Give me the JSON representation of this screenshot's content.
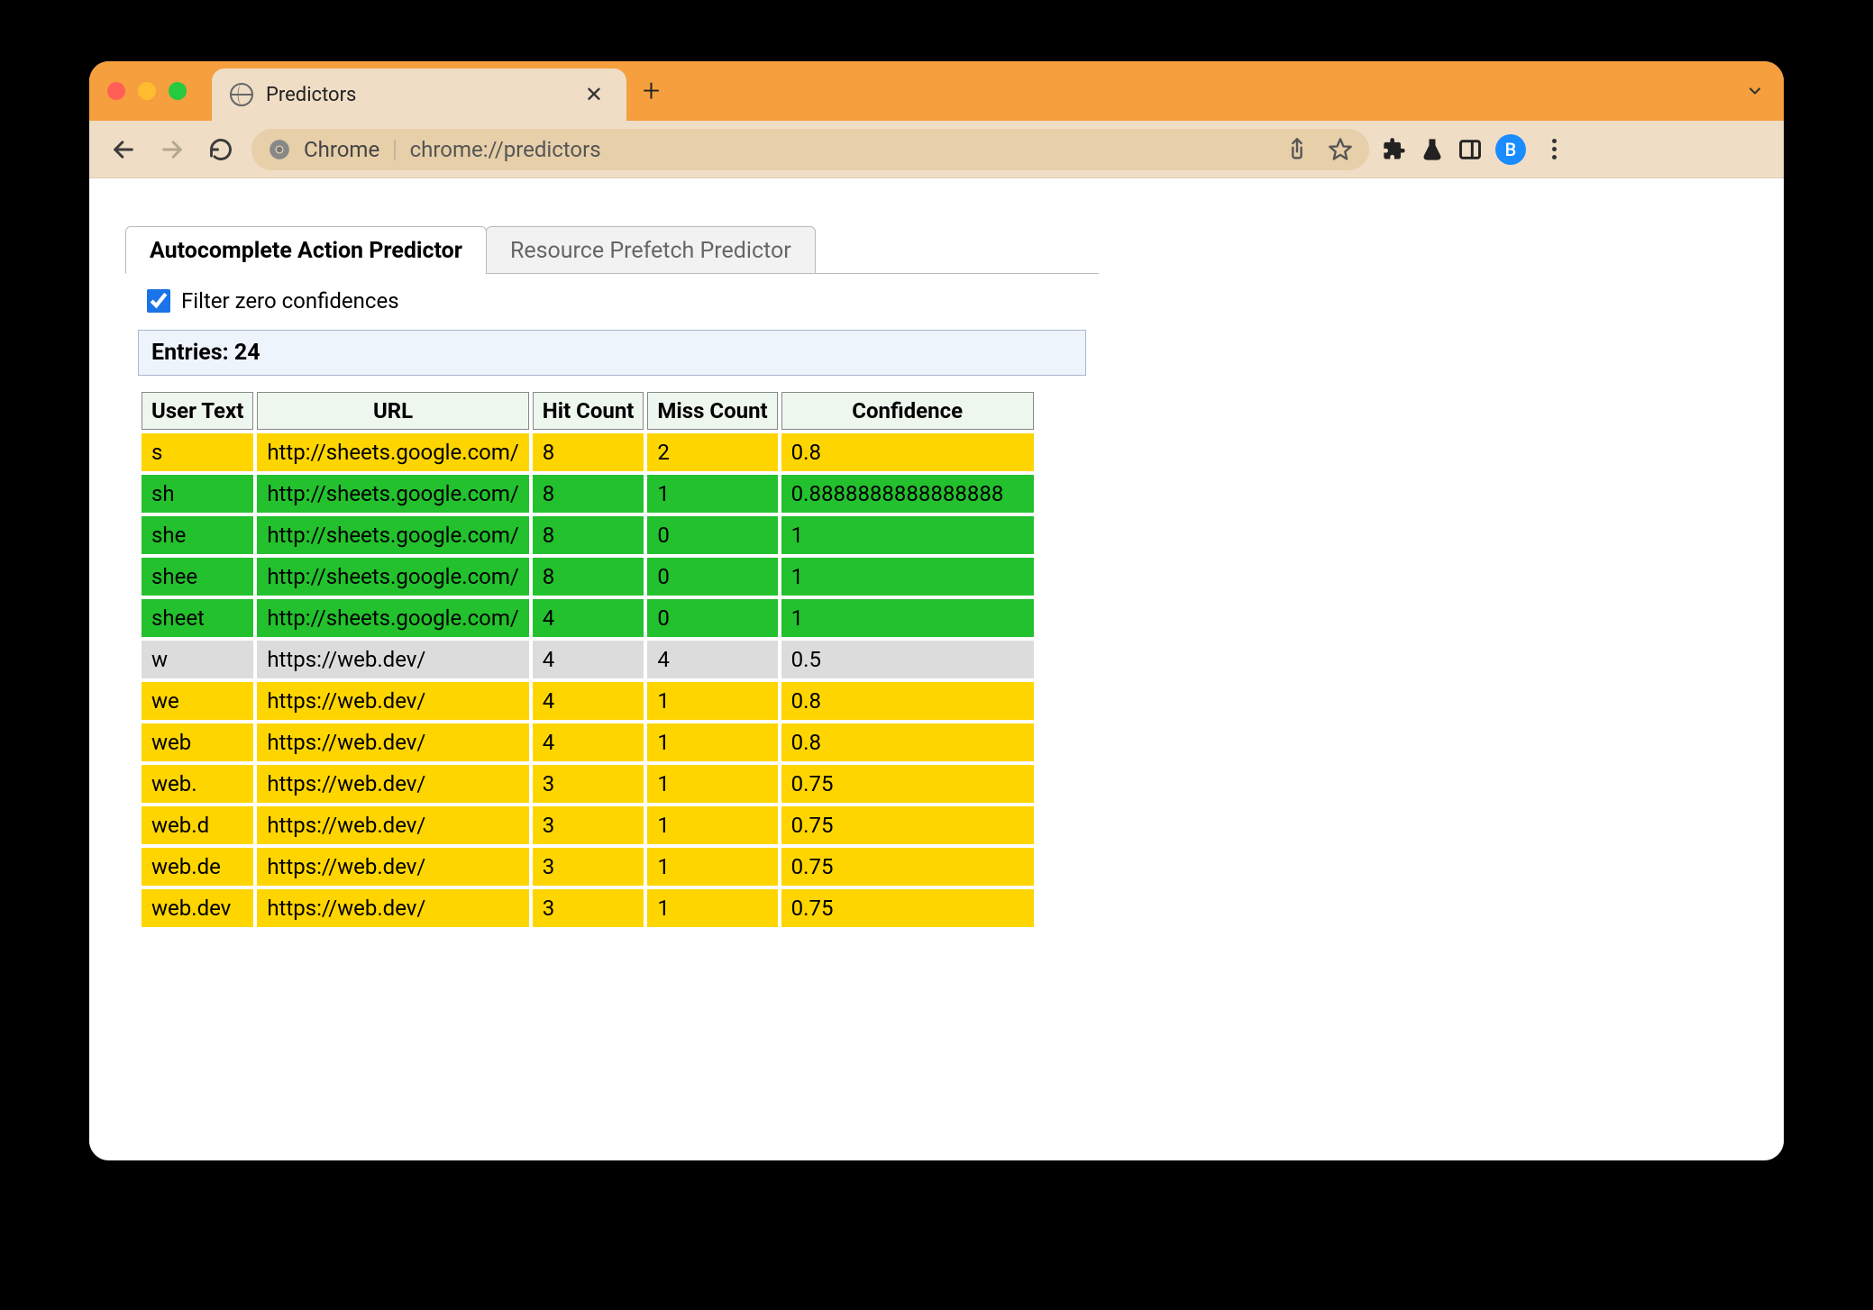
{
  "browser": {
    "tab_title": "Predictors",
    "omnibox": {
      "scheme_label": "Chrome",
      "url": "chrome://predictors"
    },
    "avatar_initial": "B"
  },
  "page": {
    "tabs": [
      {
        "label": "Autocomplete Action Predictor",
        "active": true
      },
      {
        "label": "Resource Prefetch Predictor",
        "active": false
      }
    ],
    "filter_checkbox_label": "Filter zero confidences",
    "filter_checkbox_checked": true,
    "entries_label": "Entries: 24",
    "columns": [
      "User Text",
      "URL",
      "Hit Count",
      "Miss Count",
      "Confidence"
    ],
    "rows": [
      {
        "color": "yellow",
        "user_text": "s",
        "url": "http://sheets.google.com/",
        "hit": "8",
        "miss": "2",
        "conf": "0.8"
      },
      {
        "color": "green",
        "user_text": "sh",
        "url": "http://sheets.google.com/",
        "hit": "8",
        "miss": "1",
        "conf": "0.8888888888888888"
      },
      {
        "color": "green",
        "user_text": "she",
        "url": "http://sheets.google.com/",
        "hit": "8",
        "miss": "0",
        "conf": "1"
      },
      {
        "color": "green",
        "user_text": "shee",
        "url": "http://sheets.google.com/",
        "hit": "8",
        "miss": "0",
        "conf": "1"
      },
      {
        "color": "green",
        "user_text": "sheet",
        "url": "http://sheets.google.com/",
        "hit": "4",
        "miss": "0",
        "conf": "1"
      },
      {
        "color": "grey",
        "user_text": "w",
        "url": "https://web.dev/",
        "hit": "4",
        "miss": "4",
        "conf": "0.5"
      },
      {
        "color": "yellow",
        "user_text": "we",
        "url": "https://web.dev/",
        "hit": "4",
        "miss": "1",
        "conf": "0.8"
      },
      {
        "color": "yellow",
        "user_text": "web",
        "url": "https://web.dev/",
        "hit": "4",
        "miss": "1",
        "conf": "0.8"
      },
      {
        "color": "yellow",
        "user_text": "web.",
        "url": "https://web.dev/",
        "hit": "3",
        "miss": "1",
        "conf": "0.75"
      },
      {
        "color": "yellow",
        "user_text": "web.d",
        "url": "https://web.dev/",
        "hit": "3",
        "miss": "1",
        "conf": "0.75"
      },
      {
        "color": "yellow",
        "user_text": "web.de",
        "url": "https://web.dev/",
        "hit": "3",
        "miss": "1",
        "conf": "0.75"
      },
      {
        "color": "yellow",
        "user_text": "web.dev",
        "url": "https://web.dev/",
        "hit": "3",
        "miss": "1",
        "conf": "0.75"
      }
    ]
  }
}
